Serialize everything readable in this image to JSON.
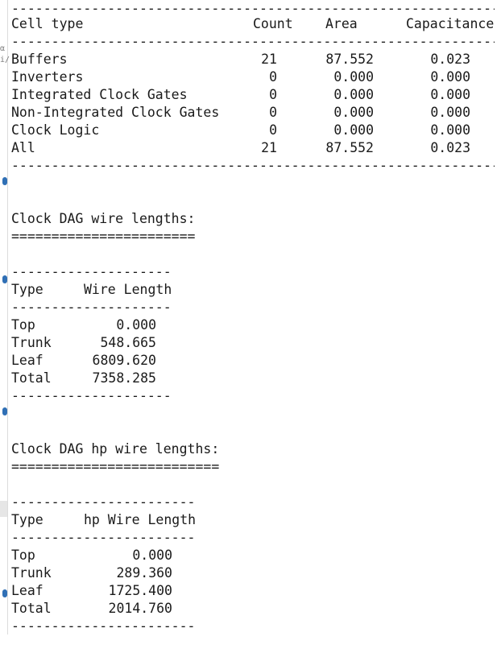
{
  "gutter": {
    "glyph_top": "α",
    "glyph_second": "i/"
  },
  "cell_table": {
    "rule": "---------------------------------------------------------------------------------",
    "headers": [
      "Cell type",
      "Count",
      "Area",
      "Capacitance"
    ],
    "rows": [
      [
        "Buffers",
        "21",
        "87.552",
        "0.023"
      ],
      [
        "Inverters",
        "0",
        "0.000",
        "0.000"
      ],
      [
        "Integrated Clock Gates",
        "0",
        "0.000",
        "0.000"
      ],
      [
        "Non-Integrated Clock Gates",
        "0",
        "0.000",
        "0.000"
      ],
      [
        "Clock Logic",
        "0",
        "0.000",
        "0.000"
      ],
      [
        "All",
        "21",
        "87.552",
        "0.023"
      ]
    ]
  },
  "wire_lengths": {
    "title": "Clock DAG wire lengths:",
    "title_underline": "=======================",
    "rule": "--------------------",
    "headers": [
      "Type",
      "Wire Length"
    ],
    "rows": [
      [
        "Top",
        "0.000"
      ],
      [
        "Trunk",
        "548.665"
      ],
      [
        "Leaf",
        "6809.620"
      ],
      [
        "Total",
        "7358.285"
      ]
    ]
  },
  "hp_wire_lengths": {
    "title": "Clock DAG hp wire lengths:",
    "title_underline": "==========================",
    "rule": "-----------------------",
    "headers": [
      "Type",
      "hp Wire Length"
    ],
    "rows": [
      [
        "Top",
        "0.000"
      ],
      [
        "Trunk",
        "289.360"
      ],
      [
        "Leaf",
        "1725.400"
      ],
      [
        "Total",
        "2014.760"
      ]
    ]
  }
}
